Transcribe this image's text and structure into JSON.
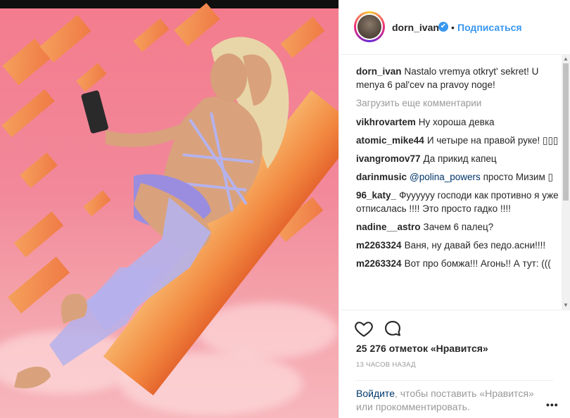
{
  "post": {
    "username": "dorn_ivan",
    "verified_symbol": "✔",
    "separator": "•",
    "follow_label": "Подписаться"
  },
  "caption": {
    "username": "dorn_ivan",
    "text": "Nastalo vremya otkryt' sekret! U menya 6 pal'cev na pravoy noge!"
  },
  "load_more_label": "Загрузить еще комментарии",
  "comments": [
    {
      "user": "vikhrovartem",
      "text": "Ну хороша девка"
    },
    {
      "user": "atomic_mike44",
      "text": "И четыре на правой руке! ▯▯▯"
    },
    {
      "user": "ivangromov77",
      "text": "Да прикид капец"
    },
    {
      "user": "darinmusic",
      "mention": "@polina_powers",
      "text": "просто Мизим ▯"
    },
    {
      "user": "96_katy_",
      "text": "Фууууyy господи как противно я уже отписалась !!!! Это просто гадко !!!!"
    },
    {
      "user": "nadine__astro",
      "text": "Зачем 6 палец?"
    },
    {
      "user": "m2263324",
      "text": "Ваня, ну давай без педо.асни!!!!"
    },
    {
      "user": "m2263324",
      "text": "Вот про бомжа!!! Агонь!! А тут: ((("
    }
  ],
  "actions": {
    "like_icon": "heart-icon",
    "comment_icon": "speech-bubble-icon"
  },
  "likes_text": "25 276 отметок «Нравится»",
  "time_text": "13 ЧАСОВ НАЗАД",
  "login": {
    "link": "Войдите",
    "rest": ", чтобы поставить «Нравится» или прокомментировать."
  },
  "more_label": "•••",
  "scrollbar": {
    "up_symbol": "▲",
    "down_symbol": "▼"
  },
  "colors": {
    "accent": "#3897f0",
    "link": "#003569",
    "muted": "#999999"
  }
}
